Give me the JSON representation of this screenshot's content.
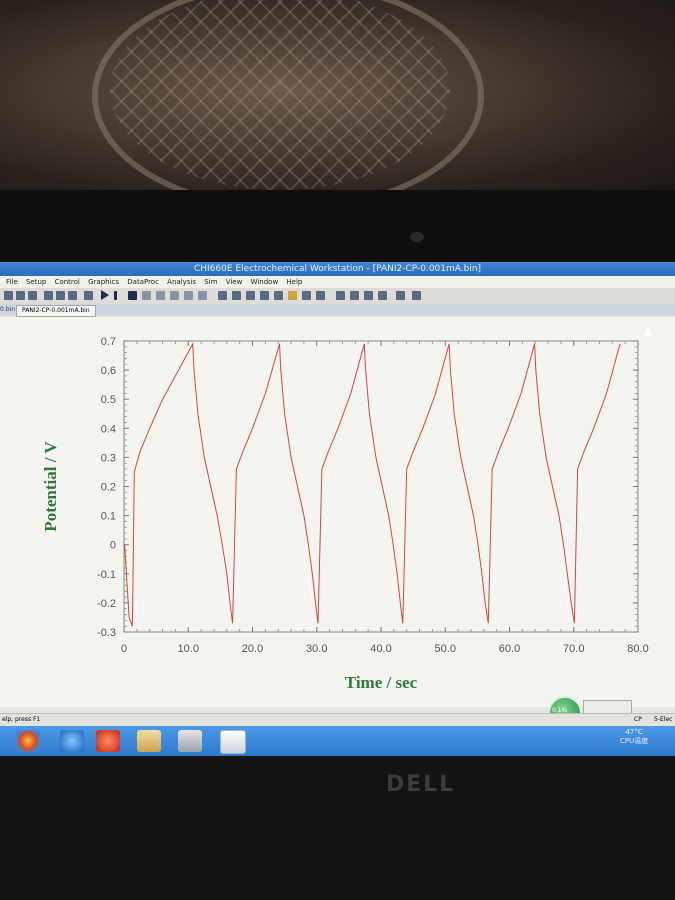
{
  "window": {
    "title": "CHI660E Electrochemical Workstation - [PANI2-CP-0.001mA.bin]"
  },
  "menu": [
    "File",
    "Setup",
    "Control",
    "Graphics",
    "DataProc",
    "Analysis",
    "Sim",
    "View",
    "Window",
    "Help"
  ],
  "tabs": {
    "previous": "0.bin",
    "active": "PANI2-CP-0.001mA.bin"
  },
  "status": {
    "left": "elp, press F1",
    "right_mode": "CP",
    "right_text": "5-Elec"
  },
  "taskbar": {
    "temp": "47°C",
    "cpu": "CPU温度"
  },
  "gadget": {
    "label": "0.1%"
  },
  "brand": {
    "logo": "DELL"
  },
  "chart_data": {
    "type": "line",
    "xlabel": "Time / sec",
    "ylabel": "Potential / V",
    "xlim": [
      0,
      80
    ],
    "ylim": [
      -0.3,
      0.7
    ],
    "x_ticks": [
      "0",
      "10.0",
      "20.0",
      "30.0",
      "40.0",
      "50.0",
      "60.0",
      "70.0",
      "80.0"
    ],
    "y_ticks": [
      "0.7",
      "0.6",
      "0.5",
      "0.4",
      "0.3",
      "0.2",
      "0.1",
      "0",
      "-0.1",
      "-0.2",
      "-0.3"
    ],
    "series": [
      {
        "color": "#c84a3a",
        "points": [
          [
            0.1,
            0.0
          ],
          [
            0.8,
            -0.25
          ],
          [
            1.3,
            -0.28
          ],
          [
            1.6,
            0.25
          ],
          [
            2.5,
            0.32
          ],
          [
            4,
            0.4
          ],
          [
            6,
            0.5
          ],
          [
            8,
            0.58
          ],
          [
            10.7,
            0.69
          ],
          [
            10.9,
            0.6
          ],
          [
            11.5,
            0.45
          ],
          [
            12.5,
            0.3
          ],
          [
            13.5,
            0.2
          ],
          [
            14.5,
            0.1
          ],
          [
            15.3,
            0.0
          ],
          [
            16,
            -0.1
          ],
          [
            16.5,
            -0.2
          ],
          [
            16.9,
            -0.27
          ],
          [
            17.5,
            0.26
          ],
          [
            18.5,
            0.32
          ],
          [
            20,
            0.4
          ],
          [
            22,
            0.52
          ],
          [
            24.2,
            0.69
          ],
          [
            24.4,
            0.6
          ],
          [
            25,
            0.45
          ],
          [
            26,
            0.3
          ],
          [
            27,
            0.2
          ],
          [
            28,
            0.1
          ],
          [
            28.7,
            0.0
          ],
          [
            29.3,
            -0.1
          ],
          [
            29.8,
            -0.2
          ],
          [
            30.2,
            -0.27
          ],
          [
            30.8,
            0.26
          ],
          [
            31.8,
            0.32
          ],
          [
            33.3,
            0.4
          ],
          [
            35.3,
            0.52
          ],
          [
            37.4,
            0.69
          ],
          [
            37.6,
            0.6
          ],
          [
            38.2,
            0.45
          ],
          [
            39.2,
            0.3
          ],
          [
            40.2,
            0.2
          ],
          [
            41.2,
            0.1
          ],
          [
            41.9,
            0.0
          ],
          [
            42.5,
            -0.1
          ],
          [
            43.0,
            -0.2
          ],
          [
            43.4,
            -0.27
          ],
          [
            44,
            0.26
          ],
          [
            45,
            0.32
          ],
          [
            46.5,
            0.4
          ],
          [
            48.5,
            0.52
          ],
          [
            50.6,
            0.69
          ],
          [
            50.8,
            0.6
          ],
          [
            51.4,
            0.45
          ],
          [
            52.4,
            0.3
          ],
          [
            53.4,
            0.2
          ],
          [
            54.4,
            0.1
          ],
          [
            55.1,
            0.0
          ],
          [
            55.7,
            -0.1
          ],
          [
            56.2,
            -0.2
          ],
          [
            56.7,
            -0.27
          ],
          [
            57.3,
            0.26
          ],
          [
            58.3,
            0.32
          ],
          [
            59.8,
            0.4
          ],
          [
            61.8,
            0.52
          ],
          [
            63.9,
            0.69
          ],
          [
            64.1,
            0.6
          ],
          [
            64.7,
            0.45
          ],
          [
            65.7,
            0.3
          ],
          [
            66.7,
            0.2
          ],
          [
            67.7,
            0.1
          ],
          [
            68.4,
            0.0
          ],
          [
            69.0,
            -0.1
          ],
          [
            69.6,
            -0.2
          ],
          [
            70.1,
            -0.27
          ],
          [
            70.6,
            0.26
          ],
          [
            71.6,
            0.32
          ],
          [
            73.1,
            0.4
          ],
          [
            75.1,
            0.52
          ],
          [
            77.2,
            0.69
          ]
        ]
      }
    ],
    "grid": false,
    "legend": "none"
  }
}
